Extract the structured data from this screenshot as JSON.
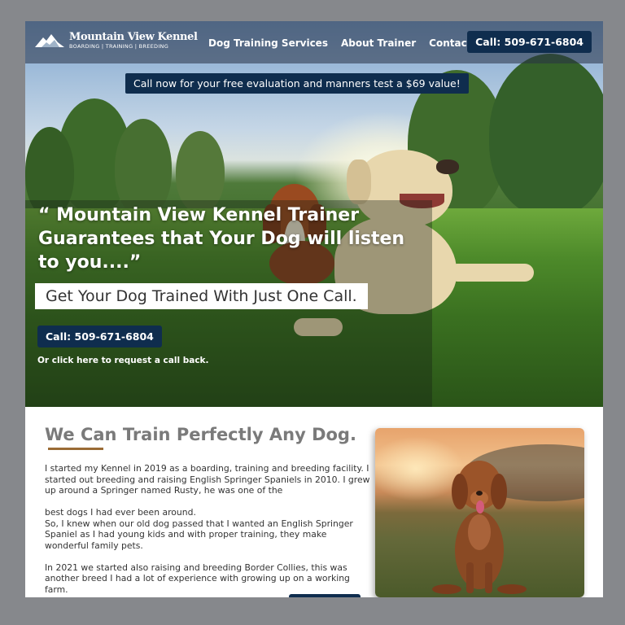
{
  "header": {
    "logo_title": "Mountain View Kennel",
    "logo_subtitle": "BOARDING | TRAINING | BREEDING",
    "nav": [
      "Dog Training Services",
      "About Trainer",
      "Contact"
    ],
    "call_button": "Call: 509-671-6804"
  },
  "hero": {
    "promo": "Call now for your free evaluation and manners test a $69 value!",
    "headline": "“ Mountain View Kennel Trainer Guarantees that Your Dog will listen to you....”",
    "subheadline": "Get Your Dog Trained With Just One Call.",
    "call_button": "Call: 509-671-6804",
    "callback_link": "Or click here to request a call back."
  },
  "content": {
    "title": "We Can Train Perfectly Any Dog.",
    "paragraphs": [
      "I started my Kennel in 2019 as a boarding, training and breeding facility. I started out breeding and raising English Springer Spaniels in 2010. I grew up around a Springer named Rusty, he was one of the",
      "best dogs I had ever been around.\nSo, I knew when our old dog passed that I wanted an English Springer Spaniel as I had young kids and with proper training, they make wonderful family pets.",
      "In 2021 we started also raising and breeding Border Collies, this was another breed I had a lot of experience with growing up on a working farm."
    ]
  },
  "colors": {
    "accent_navy": "#0f2d4e",
    "title_gray": "#7a7a7a",
    "rule_brown": "#9a6b35"
  },
  "icons": [
    "mountain-logo-icon"
  ]
}
